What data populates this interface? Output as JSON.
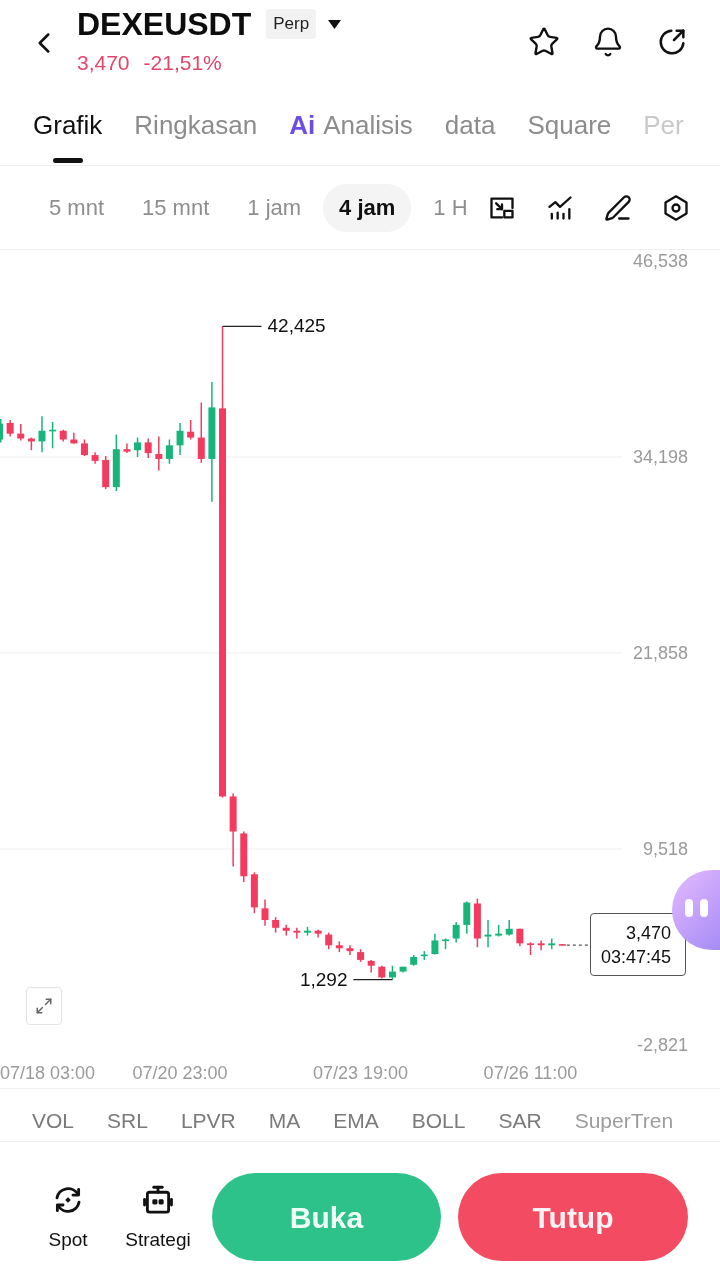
{
  "header": {
    "symbol": "DEXEUSDT",
    "contract_type": "Perp",
    "last_price": "3,470",
    "change": "-21,51%"
  },
  "tabs": [
    {
      "label": "Grafik",
      "selected": true
    },
    {
      "label": "Ringkasan",
      "selected": false
    },
    {
      "badge": "Ai",
      "label": "Analisis",
      "selected": false
    },
    {
      "label": "data",
      "selected": false
    },
    {
      "label": "Square",
      "selected": false
    },
    {
      "label": "Per",
      "selected": false
    }
  ],
  "intervals": [
    {
      "label": "5 mnt",
      "selected": false
    },
    {
      "label": "15 mnt",
      "selected": false
    },
    {
      "label": "1 jam",
      "selected": false
    },
    {
      "label": "4 jam",
      "selected": true
    },
    {
      "label": "1 H",
      "selected": false
    }
  ],
  "chart": {
    "chart_data": {
      "type": "candlestick",
      "categories": [
        null,
        null,
        null,
        null,
        null,
        null,
        null,
        null,
        null,
        null,
        null,
        null,
        null,
        null,
        null,
        null,
        null,
        "07/20 23:00",
        null,
        null,
        null,
        null,
        null,
        null,
        null,
        null,
        null,
        null,
        null,
        null,
        null,
        null,
        null,
        null,
        "07/23 19:00",
        null,
        null,
        null,
        null,
        null,
        null,
        null,
        null,
        null,
        null,
        null,
        null,
        null,
        null,
        null,
        "07/26 11:00",
        null,
        null,
        null
      ],
      "ohlc": [
        [
          35300,
          36586,
          35117,
          36299
        ],
        [
          36341,
          36525,
          35484,
          35668
        ],
        [
          35668,
          36280,
          35239,
          35362
        ],
        [
          35362,
          35423,
          34627,
          35178
        ],
        [
          35178,
          36770,
          34504,
          35851
        ],
        [
          35821,
          36403,
          34749,
          35913
        ],
        [
          35851,
          35913,
          35178,
          35300
        ],
        [
          35300,
          35729,
          35025,
          35055
        ],
        [
          35055,
          35300,
          34259,
          34320
        ],
        [
          34320,
          34504,
          33769,
          33953
        ],
        [
          34014,
          34259,
          32177,
          32300
        ],
        [
          32300,
          35607,
          32055,
          34688
        ],
        [
          34688,
          35055,
          34443,
          34535
        ],
        [
          34627,
          35423,
          34198,
          35117
        ],
        [
          35117,
          35362,
          34137,
          34443
        ],
        [
          34382,
          35484,
          33341,
          34076
        ],
        [
          34076,
          35300,
          33769,
          34933
        ],
        [
          34933,
          36341,
          34320,
          35851
        ],
        [
          35790,
          36525,
          35300,
          35423
        ],
        [
          35423,
          37627,
          33831,
          34076
        ],
        [
          34076,
          38913,
          31381,
          37321
        ],
        [
          37260,
          42425,
          12764,
          12825
        ],
        [
          12825,
          13009,
          8416,
          10621
        ],
        [
          10498,
          10621,
          7436,
          7804
        ],
        [
          7926,
          8049,
          5476,
          5844
        ],
        [
          5783,
          6334,
          4680,
          5048
        ],
        [
          5048,
          5231,
          4252,
          4558
        ],
        [
          4558,
          4742,
          4068,
          4374
        ],
        [
          4374,
          4558,
          3884,
          4252
        ],
        [
          4252,
          4619,
          4068,
          4374
        ],
        [
          4374,
          4435,
          3945,
          4190
        ],
        [
          4129,
          4252,
          3211,
          3456
        ],
        [
          3456,
          3700,
          3027,
          3272
        ],
        [
          3272,
          3456,
          2843,
          3088
        ],
        [
          3027,
          3211,
          2414,
          2537
        ],
        [
          2476,
          2537,
          1741,
          2169
        ],
        [
          2108,
          2169,
          1373,
          1435
        ],
        [
          1435,
          2169,
          1292,
          1802
        ],
        [
          1802,
          2108,
          1741,
          2108
        ],
        [
          2231,
          2843,
          2169,
          2721
        ],
        [
          2782,
          3088,
          2537,
          2874
        ],
        [
          2904,
          4190,
          2874,
          3762
        ],
        [
          3731,
          3884,
          3211,
          3823
        ],
        [
          3884,
          4925,
          3639,
          4742
        ],
        [
          4742,
          6211,
          4190,
          6150
        ],
        [
          6089,
          6395,
          3333,
          3884
        ],
        [
          4007,
          5048,
          3333,
          4129
        ],
        [
          4068,
          4742,
          4007,
          4190
        ],
        [
          4129,
          5048,
          4068,
          4497
        ],
        [
          4497,
          4497,
          3394,
          3578
        ],
        [
          3578,
          3639,
          2843,
          3486
        ],
        [
          3578,
          3762,
          3149,
          3456
        ],
        [
          3456,
          3884,
          3211,
          3578
        ],
        [
          3530,
          3540,
          3470,
          3470
        ]
      ],
      "ylim": [
        -2821,
        46538
      ],
      "yticks": [
        {
          "value": 46538,
          "label": "46,538"
        },
        {
          "value": 34198,
          "label": "34,198"
        },
        {
          "value": 21858,
          "label": "21,858"
        },
        {
          "value": 9518,
          "label": "9,518"
        },
        {
          "value": -2821,
          "label": "-2,821"
        }
      ],
      "grid": true,
      "annotations": [
        "42,425",
        "1,292"
      ]
    },
    "time_axis_start": "07/18 03:00",
    "last_price_tag": {
      "price": "3,470",
      "countdown": "03:47:45"
    }
  },
  "indicators": [
    "VOL",
    "SRL",
    "LPVR",
    "MA",
    "EMA",
    "BOLL",
    "SAR",
    "SuperTren"
  ],
  "bottom_bar": {
    "shortcuts": [
      {
        "kind": "spot",
        "label": "Spot"
      },
      {
        "kind": "strategy",
        "label": "Strategi"
      }
    ],
    "buttons": [
      {
        "kind": "open",
        "label": "Buka"
      },
      {
        "kind": "close",
        "label": "Tutup"
      }
    ]
  }
}
